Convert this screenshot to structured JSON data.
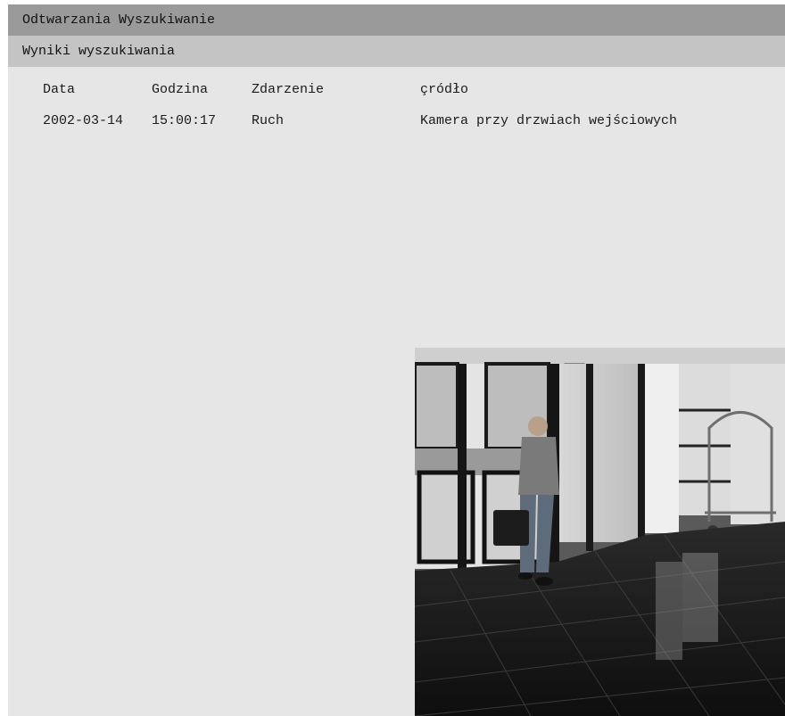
{
  "window": {
    "title": "Odtwarzania Wyszukiwanie"
  },
  "results": {
    "section_title": "Wyniki wyszukiwania",
    "columns": [
      "Data",
      "Godzina",
      "Zdarzenie",
      "çródło"
    ],
    "rows": [
      {
        "date": "2002-03-14",
        "time": "15:00:17",
        "event": "Ruch",
        "source": "Kamera przy drzwiach wejściowych"
      }
    ]
  },
  "preview": {
    "icon": "camera-snapshot",
    "sign_text": "🚶 ↓"
  }
}
